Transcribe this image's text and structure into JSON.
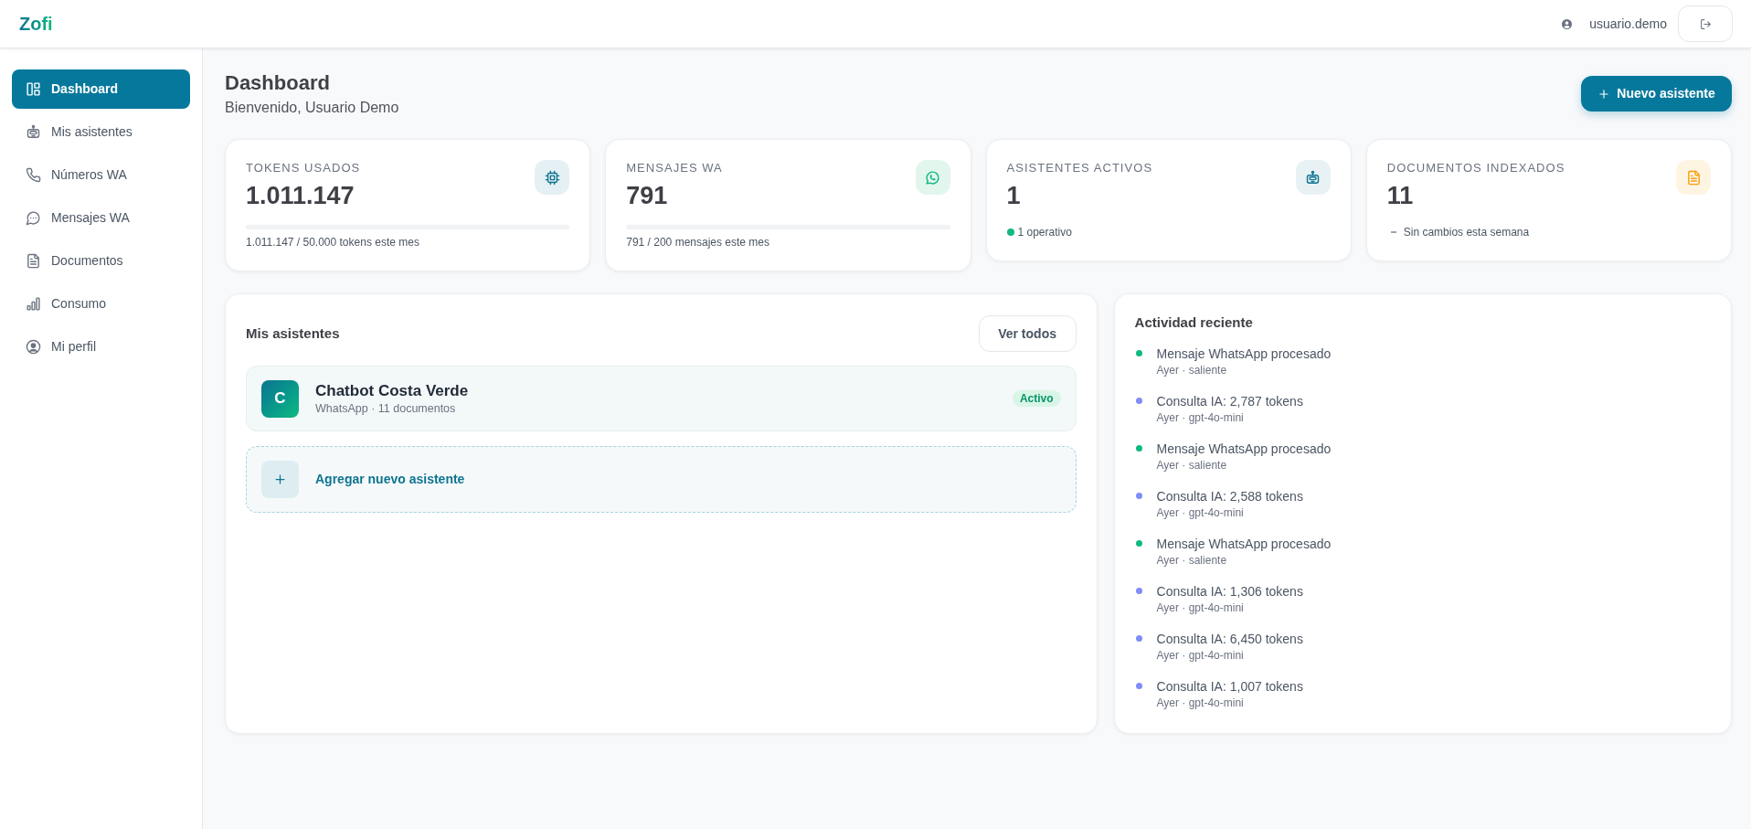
{
  "topbar": {
    "logo": "Zofi",
    "username": "usuario.demo"
  },
  "sidebar": {
    "items": [
      {
        "label": "Dashboard",
        "selected": true
      },
      {
        "label": "Mis asistentes",
        "selected": false
      },
      {
        "label": "Números WA",
        "selected": false
      },
      {
        "label": "Mensajes WA",
        "selected": false
      },
      {
        "label": "Documentos",
        "selected": false
      },
      {
        "label": "Consumo",
        "selected": false
      },
      {
        "label": "Mi perfil",
        "selected": false
      }
    ]
  },
  "header": {
    "title": "Dashboard",
    "subtitle": "Bienvenido, Usuario Demo",
    "new_button": "Nuevo asistente"
  },
  "stats": [
    {
      "kind": "progress",
      "label": "TOKENS USADOS",
      "value": "1.011.147",
      "level": 0,
      "note": "1.011.147 / 50.000 tokens este mes"
    },
    {
      "kind": "progress",
      "label": "MENSAJES WA",
      "value": "791",
      "level": 0,
      "note": "791 / 200 mensajes este mes"
    },
    {
      "kind": "status",
      "label": "ASISTENTES ACTIVOS",
      "value": "1",
      "note": "1 operativo"
    },
    {
      "kind": "neutral",
      "label": "DOCUMENTOS INDEXADOS",
      "value": "11",
      "note": "Sin cambios esta semana"
    }
  ],
  "assistants": {
    "title": "Mis asistentes",
    "view_all": "Ver todos",
    "items": [
      {
        "initial": "C",
        "name": "Chatbot Costa Verde",
        "meta": "WhatsApp · 11 documentos",
        "status": "Activo",
        "active": true
      }
    ],
    "add_label": "Agregar nuevo asistente"
  },
  "activity": {
    "title": "Actividad reciente",
    "items": [
      {
        "title": "Mensaje WhatsApp procesado",
        "meta": "Ayer · saliente",
        "color": "#10b981"
      },
      {
        "title": "Consulta IA: 2,787 tokens",
        "meta": "Ayer · gpt-4o-mini",
        "color": "#818cf8"
      },
      {
        "title": "Mensaje WhatsApp procesado",
        "meta": "Ayer · saliente",
        "color": "#10b981"
      },
      {
        "title": "Consulta IA: 2,588 tokens",
        "meta": "Ayer · gpt-4o-mini",
        "color": "#818cf8"
      },
      {
        "title": "Mensaje WhatsApp procesado",
        "meta": "Ayer · saliente",
        "color": "#10b981"
      },
      {
        "title": "Consulta IA: 1,306 tokens",
        "meta": "Ayer · gpt-4o-mini",
        "color": "#818cf8"
      },
      {
        "title": "Consulta IA: 6,450 tokens",
        "meta": "Ayer · gpt-4o-mini",
        "color": "#818cf8"
      },
      {
        "title": "Consulta IA: 1,007 tokens",
        "meta": "Ayer · gpt-4o-mini",
        "color": "#818cf8"
      }
    ]
  }
}
